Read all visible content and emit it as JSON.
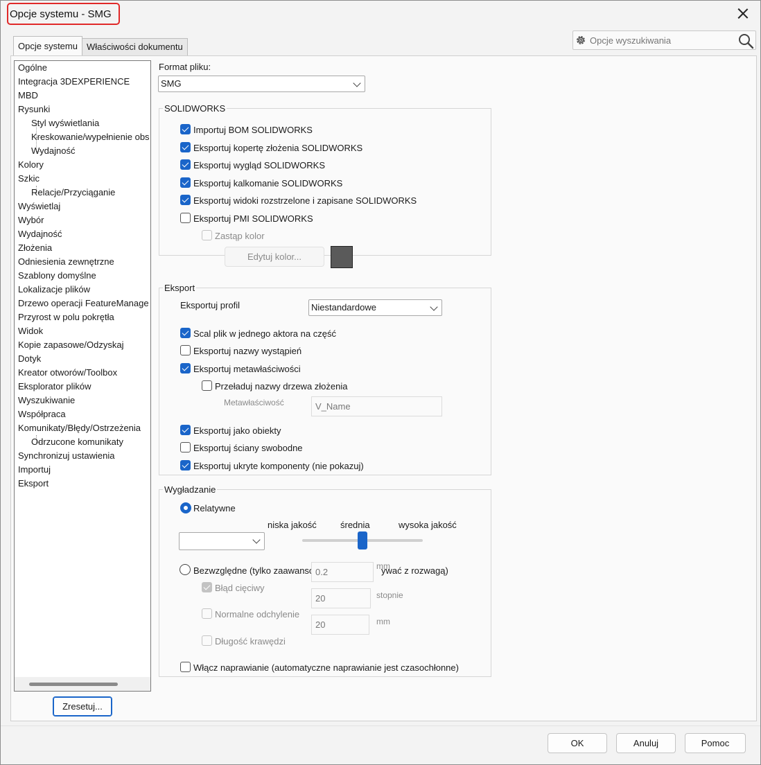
{
  "window": {
    "title": "Opcje systemu - SMG"
  },
  "tabs": [
    "Opcje systemu",
    "Właściwości dokumentu"
  ],
  "search": {
    "placeholder": "Opcje wyszukiwania"
  },
  "tree": {
    "items": [
      "Ogólne",
      "Integracja 3DEXPERIENCE",
      "MBD",
      "Rysunki",
      "Styl wyświetlania",
      "Kreskowanie/wypełnienie obs",
      "Wydajność",
      "Kolory",
      "Szkic",
      "Relacje/Przyciąganie",
      "Wyświetlaj",
      "Wybór",
      "Wydajność",
      "Złożenia",
      "Odniesienia zewnętrzne",
      "Szablony domyślne",
      "Lokalizacje plików",
      "Drzewo operacji FeatureManage",
      "Przyrost w polu pokrętła",
      "Widok",
      "Kopie zapasowe/Odzyskaj",
      "Dotyk",
      "Kreator otworów/Toolbox",
      "Eksplorator plików",
      "Wyszukiwanie",
      "Współpraca",
      "Komunikaty/Błędy/Ostrzeżenia",
      "Odrzucone komunikaty",
      "Synchronizuj ustawienia",
      "Importuj",
      "Eksport"
    ]
  },
  "reset_button": "Zresetuj...",
  "format": {
    "label": "Format pliku:",
    "value": "SMG"
  },
  "solidworks": {
    "title": "SOLIDWORKS",
    "import_bom": "Importuj BOM SOLIDWORKS",
    "export_envelope": "Eksportuj kopertę złożenia SOLIDWORKS",
    "export_appearance": "Eksportuj wygląd SOLIDWORKS",
    "export_decals": "Eksportuj kalkomanie SOLIDWORKS",
    "export_views": "Eksportuj widoki rozstrzelone i zapisane SOLIDWORKS",
    "export_pmi": "Eksportuj PMI SOLIDWORKS",
    "override_color": "Zastąp kolor",
    "edit_color": "Edytuj kolor...",
    "swatch_color": "#5a5a5a"
  },
  "export": {
    "title": "Eksport",
    "profile_label": "Eksportuj profil",
    "profile_value": "Niestandardowe",
    "merge": "Scal plik w jednego aktora na część",
    "names": "Eksportuj nazwy wystąpień",
    "meta": "Eksportuj metawłaściwości",
    "reload_names": "Przeładuj nazwy drzewa złożenia",
    "meta_label": "Metawłaściwość",
    "meta_value": "V_Name",
    "objects": "Eksportuj jako obiekty",
    "free_faces": "Eksportuj ściany swobodne",
    "hidden": "Eksportuj ukryte komponenty (nie pokazuj)"
  },
  "smoothing": {
    "title": "Wygładzanie",
    "relative": "Relatywne",
    "low": "niska jakość",
    "medium": "średnia",
    "high": "wysoka jakość",
    "slider_level": 0.5,
    "absolute": "Bezwzględne (tylko zaawanso",
    "absolute_tail": "ywać z rozwagą)",
    "absolute_unit_ghost": "mm",
    "chord_error": "Błąd cięciwy",
    "chord_value": "0.2",
    "normal_dev": "Normalne odchylenie",
    "normal_value": "20",
    "normal_unit": "stopnie",
    "edge_length": "Długość krawędzi",
    "edge_value": "20",
    "edge_unit": "mm",
    "repair": "Włącz naprawianie (automatyczne naprawianie jest czasochłonne)"
  },
  "footer": {
    "ok": "OK",
    "cancel": "Anuluj",
    "help": "Pomoc"
  },
  "colors": {
    "accent": "#1a65c9",
    "title_highlight": "#e02828"
  }
}
